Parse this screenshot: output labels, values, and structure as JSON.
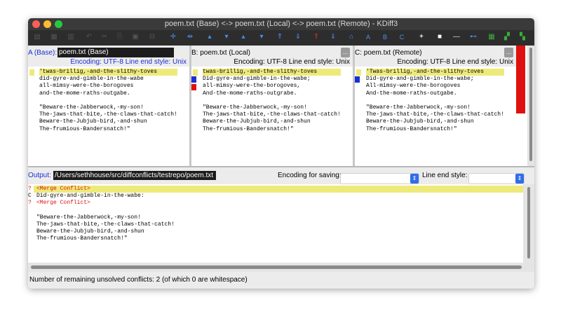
{
  "window": {
    "title": "poem.txt (Base) <-> poem.txt (Local) <-> poem.txt (Remote) - KDiff3",
    "traffic_lights": [
      "#fd5f57",
      "#fdbc2e",
      "#27c841"
    ]
  },
  "toolbar": {
    "icons": [
      "save-icon",
      "open-icon",
      "reload-icon",
      "undo-icon",
      "cut-icon",
      "copy-icon",
      "paste-icon",
      "split-icon",
      "crosshair-icon",
      "fit-icon",
      "arrow-up-icon",
      "arrow-down-icon",
      "arrow-up-icon",
      "arrow-down-icon",
      "double-up-icon",
      "double-down-icon",
      "conflict-up-icon",
      "conflict-down-icon",
      "home-icon",
      "choose-a-icon",
      "choose-b-icon",
      "choose-c-icon",
      "wizard-icon",
      "square-icon",
      "dash-icon",
      "link-icon",
      "overview-a-icon",
      "overview-b-icon",
      "overview-c-icon"
    ],
    "labels": {
      "a": "A",
      "b": "B",
      "c": "C",
      "dash": "—"
    }
  },
  "pane_a": {
    "label": "A (Base):",
    "filename": "poem.txt (Base)",
    "encoding": "Encoding: UTF-8 Line end style: Unix",
    "lines": [
      "'twas-brillig,-and-the-slithy-toves",
      "did-gyre-and-gimble-in-the-wabe",
      "all-mimsy-were-the-borogoves",
      "and-the-mome-raths-outgabe.",
      "",
      "\"Beware-the-Jabberwock,-my-son!",
      "The-jaws-that-bite,-the-claws-that-catch!",
      "Beware-the-Jubjub-bird,-and-shun",
      "The-frumious-Bandersnatch!\""
    ]
  },
  "pane_b": {
    "label": "B: poem.txt (Local)",
    "dots": "...",
    "encoding": "Encoding: UTF-8 Line end style: Unix",
    "lines": [
      "twas-brillig,-and-the-slithy-toves",
      "Did-gyre-and-gimble-in-the-wabe;",
      "all-mimsy-were-the-borogoves,",
      "And-the-mome-raths-outgrabe.",
      "",
      "\"Beware-the-Jabberwock,-my-son!",
      "The-jaws-that-bite,-the-claws-that-catch!",
      "Beware-the-Jubjub-bird,-and-shun",
      "The-frumious-Bandersnatch!\""
    ]
  },
  "pane_c": {
    "label": "C: poem.txt (Remote)",
    "dots": "...",
    "encoding": "Encoding: UTF-8 Line end style: Unix",
    "lines": [
      "'Twas-brillig,-and-the-slithy-toves",
      "Did-gyre-and-gimble-in-the-wabe;",
      "All-mimsy-were-the-borogoves",
      "And-the-mome-raths-outgabe.",
      "",
      "\"Beware-the-Jabberwock,-my-son!",
      "The-jaws-that-bite,-the-claws-that-catch!",
      "Beware-the-Jubjub-bird,-and-shun",
      "The-frumious-Bandersnatch!\""
    ]
  },
  "output": {
    "label": "Output:",
    "path": "/Users/sethhouse/src/diffconflicts/testrepo/poem.txt",
    "encoding_label": "Encoding for saving:",
    "line_end_label": "Line end style:",
    "markers": [
      "?",
      "C",
      "?"
    ],
    "lines": [
      "<Merge Conflict>",
      "Did-gyre-and-gimble-in-the-wabe:",
      "<Merge Conflict>",
      "",
      "\"Beware-the-Jabberwock,-my-son!",
      "The-jaws-that-bite,-the-claws-that-catch!",
      "Beware-the-Jubjub-bird,-and-shun",
      "The-frumious-Bandersnatch!\""
    ]
  },
  "status": {
    "text": "Number of remaining unsolved conflicts: 2 (of which 0 are whitespace)"
  },
  "colors": {
    "conflict_yellow": "#eeea7a",
    "diff_blue": "#1b2fd6",
    "diff_red": "#e01010",
    "merge_red": "#e01010"
  }
}
